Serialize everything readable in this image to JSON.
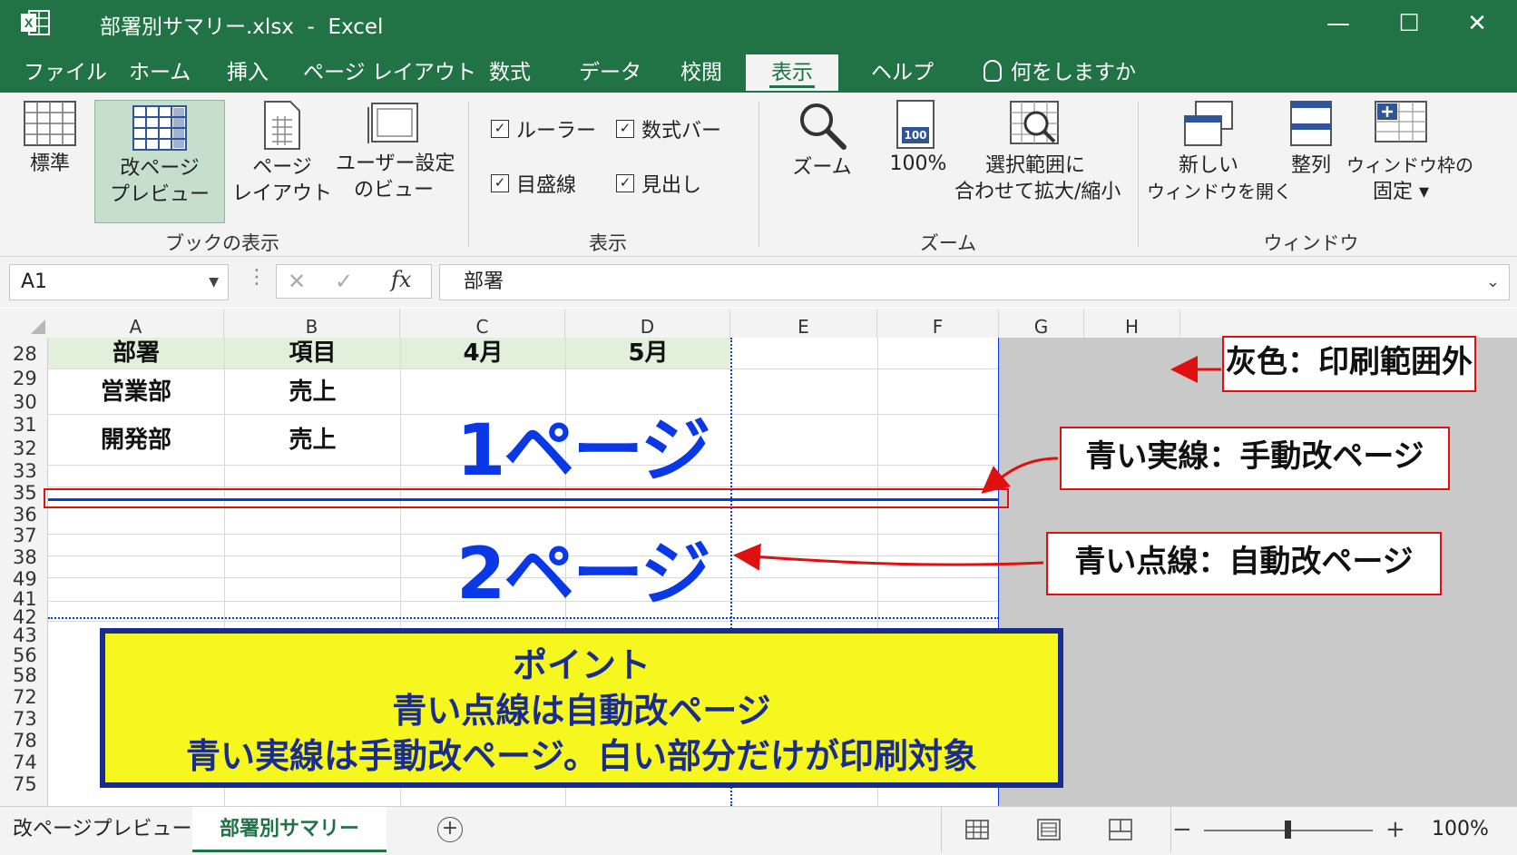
{
  "window": {
    "title": "部署別サマリー.xlsx  -  Excel",
    "minimize": "—",
    "maximize": "☐",
    "close": "✕"
  },
  "tabs": [
    {
      "label": "ファイル"
    },
    {
      "label": "ホーム"
    },
    {
      "label": "挿入"
    },
    {
      "label": "ページ レイアウト"
    },
    {
      "label": "数式"
    },
    {
      "label": "データ"
    },
    {
      "label": "校閲"
    },
    {
      "label": "表示",
      "active": true
    },
    {
      "label": "ヘルプ"
    },
    {
      "label": "何をしますか"
    }
  ],
  "ribbon": {
    "workbook_views": {
      "group_label": "ブックの表示",
      "normal": "標準",
      "page_break_preview": [
        "改ページ",
        "プレビュー"
      ],
      "page_layout": [
        "ページ",
        "レイアウト"
      ],
      "custom_views": [
        "ユーザー設定",
        "のビュー"
      ]
    },
    "show": {
      "group_label": "表示",
      "ruler": "ルーラー",
      "formula_bar": "数式バー",
      "gridlines": "目盛線",
      "headings": "見出し",
      "check_mark": "✓"
    },
    "zoom": {
      "group_label": "ズーム",
      "zoom": "ズーム",
      "hundred": "100%",
      "badge": "100",
      "zoom_to_selection": [
        "選択範囲に",
        "合わせて拡大/縮小"
      ]
    },
    "window": {
      "group_label": "ウィンドウ",
      "new_window": [
        "新しい",
        "ウィンドウを開く"
      ],
      "arrange": "整列",
      "freeze": [
        "ウィンドウ枠の",
        "固定 ▾"
      ]
    }
  },
  "formula_bar": {
    "name_box": "A1",
    "cancel": "✕",
    "enter": "✓",
    "fx": "fx",
    "value": "部署"
  },
  "columns": [
    "A",
    "B",
    "C",
    "D",
    "E",
    "F",
    "G",
    "H"
  ],
  "rows": [
    "28",
    "29",
    "30",
    "31",
    "32",
    "33",
    "35",
    "36",
    "37",
    "38",
    "49",
    "41",
    "42",
    "43",
    "56",
    "58",
    "72",
    "73",
    "78",
    "74",
    "75"
  ],
  "table": {
    "headers": [
      "部署",
      "項目",
      "4月",
      "5月"
    ],
    "rows": [
      [
        "営業部",
        "売上"
      ],
      [
        "開発部",
        "売上"
      ]
    ]
  },
  "overlay": {
    "page1": "1ページ",
    "page2": "2ページ",
    "callout_grey": "灰色：印刷範囲外",
    "callout_solid": "青い実線：手動改ページ",
    "callout_dotted": "青い点線：自動改ページ",
    "point_lines": [
      "ポイント",
      "青い点線は自動改ページ",
      "青い実線は手動改ページ。白い部分だけが印刷対象"
    ]
  },
  "sheet_tabs": {
    "preview_label": "改ページプレビュー",
    "active_sheet": "部署別サマリー",
    "add": "+"
  },
  "status": {
    "zoom_minus": "−",
    "zoom_plus": "+",
    "zoom_level": "100%"
  },
  "colors": {
    "excel_green": "#217346",
    "page_break_blue": "#0a38e6",
    "callout_red": "#e01010",
    "header_fill": "#e2efda",
    "note_yellow": "#f7f720",
    "note_border": "#1a2d8c"
  }
}
